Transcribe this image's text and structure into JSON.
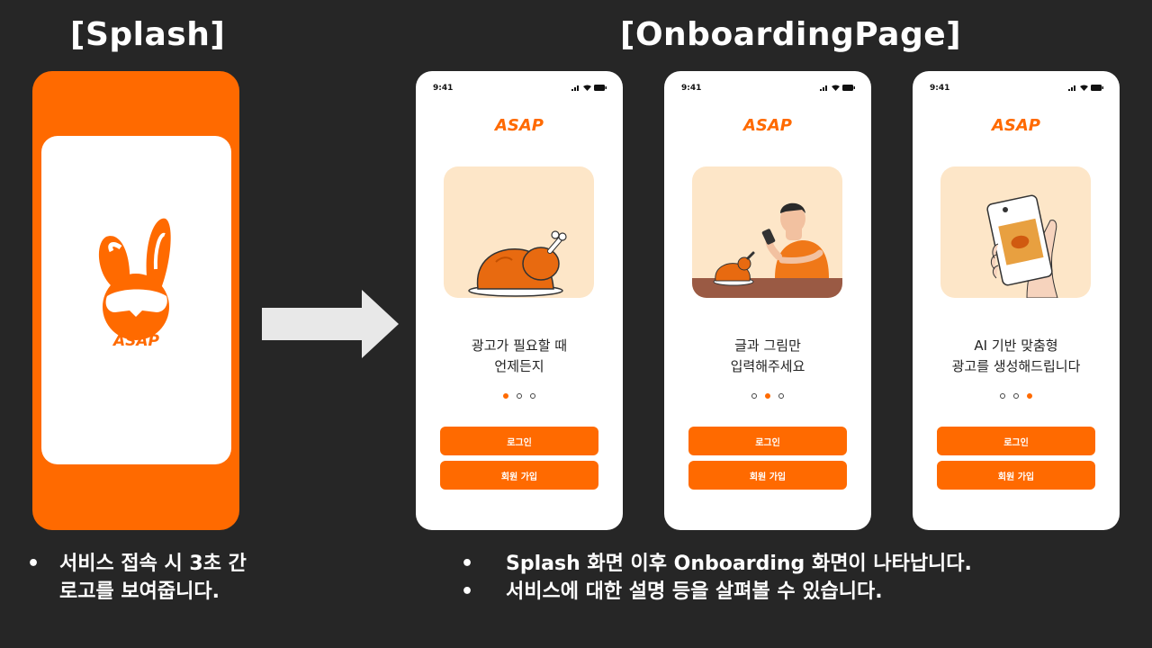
{
  "headings": {
    "splash": "[Splash]",
    "onboarding": "[OnboardingPage]"
  },
  "splash": {
    "logo_text": "ASAP",
    "accent": "#ff6a00",
    "icon": "rabbit-logo-icon"
  },
  "phones": [
    {
      "time": "9:41",
      "brand": "ASAP",
      "desc_line1": "광고가 필요할 때",
      "desc_line2": "언제든지",
      "active_dot": 0,
      "login": "로그인",
      "signup": "회원 가입",
      "illustration": "roast-chicken"
    },
    {
      "time": "9:41",
      "brand": "ASAP",
      "desc_line1": "글과 그림만",
      "desc_line2": "입력해주세요",
      "active_dot": 1,
      "login": "로그인",
      "signup": "회원 가입",
      "illustration": "man-with-phone"
    },
    {
      "time": "9:41",
      "brand": "ASAP",
      "desc_line1": "AI 기반 맞춤형",
      "desc_line2": "광고를 생성해드립니다",
      "active_dot": 2,
      "login": "로그인",
      "signup": "회원 가입",
      "illustration": "hand-holding-phone"
    }
  ],
  "notes": {
    "splash": [
      "서비스 접속 시 3초 간",
      "로고를 보여줍니다."
    ],
    "onboarding": [
      "Splash 화면 이후 Onboarding 화면이 나타납니다.",
      "서비스에 대한 설명 등을 살펴볼 수 있습니다."
    ]
  },
  "bullet": "•",
  "colors": {
    "background": "#262626",
    "accent": "#ff6a00",
    "illustration_bg": "#fde6c8"
  }
}
